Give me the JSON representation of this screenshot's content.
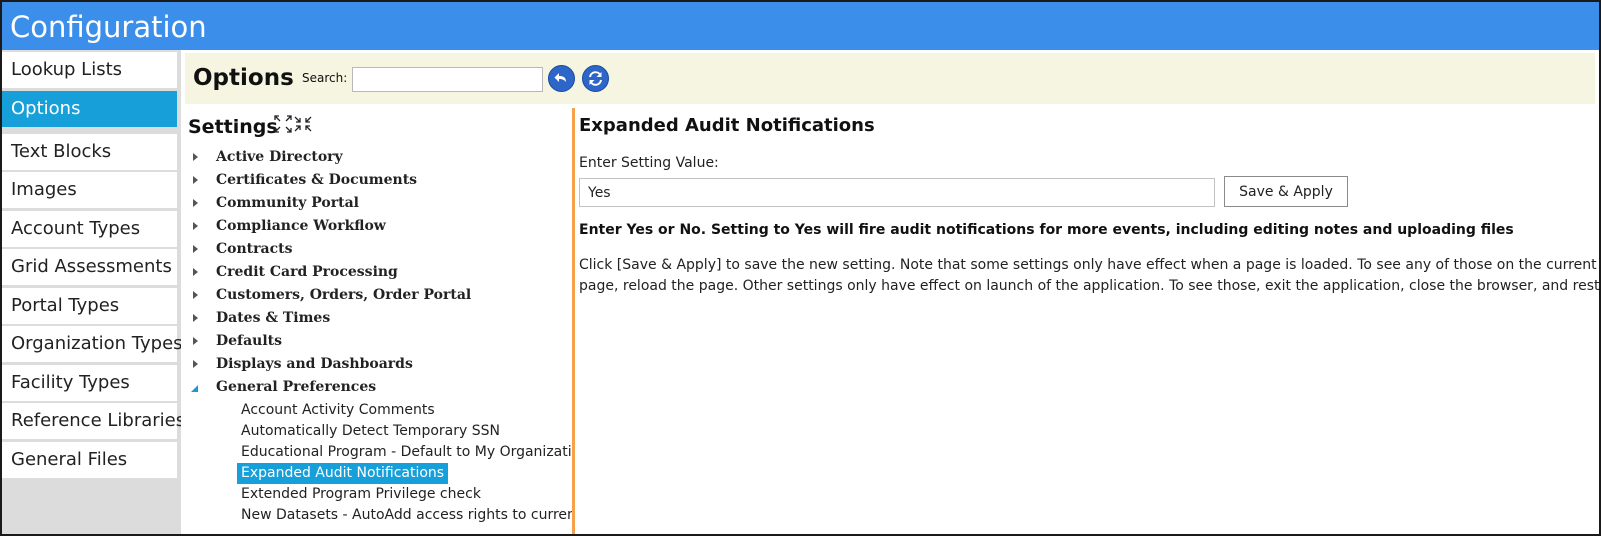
{
  "app": {
    "title": "Configuration"
  },
  "sidebar": {
    "items": [
      {
        "label": "Lookup Lists",
        "active": false
      },
      {
        "label": "Options",
        "active": true
      },
      {
        "label": "Text Blocks",
        "active": false
      },
      {
        "label": "Images",
        "active": false
      },
      {
        "label": "Account Types",
        "active": false
      },
      {
        "label": "Grid Assessments",
        "active": false
      },
      {
        "label": "Portal Types",
        "active": false
      },
      {
        "label": "Organization Types",
        "active": false
      },
      {
        "label": "Facility Types",
        "active": false
      },
      {
        "label": "Reference Libraries",
        "active": false
      },
      {
        "label": "General Files",
        "active": false
      }
    ]
  },
  "toolbar": {
    "title": "Options",
    "search_label": "Search:",
    "search_value": "",
    "back_icon": "back-arrow-icon",
    "refresh_icon": "refresh-icon"
  },
  "settings": {
    "title": "Settings",
    "expand_icon": "expand-all-icon",
    "collapse_icon": "collapse-all-icon",
    "categories": [
      {
        "label": "Active Directory",
        "expanded": false
      },
      {
        "label": "Certificates & Documents",
        "expanded": false
      },
      {
        "label": "Community Portal",
        "expanded": false
      },
      {
        "label": "Compliance Workflow",
        "expanded": false
      },
      {
        "label": "Contracts",
        "expanded": false
      },
      {
        "label": "Credit Card Processing",
        "expanded": false
      },
      {
        "label": "Customers, Orders, Order Portal",
        "expanded": false
      },
      {
        "label": "Dates & Times",
        "expanded": false
      },
      {
        "label": "Defaults",
        "expanded": false
      },
      {
        "label": "Displays and Dashboards",
        "expanded": false
      },
      {
        "label": "General Preferences",
        "expanded": true
      }
    ],
    "children": [
      {
        "label": "Account Activity Comments",
        "selected": false
      },
      {
        "label": "Automatically Detect Temporary SSN",
        "selected": false
      },
      {
        "label": "Educational Program - Default to My Organization",
        "selected": false
      },
      {
        "label": "Expanded Audit Notifications",
        "selected": true
      },
      {
        "label": "Extended Program Privilege check",
        "selected": false
      },
      {
        "label": "New Datasets - AutoAdd access rights to current user",
        "selected": false
      }
    ]
  },
  "detail": {
    "title": "Expanded Audit Notifications",
    "value_label": "Enter Setting Value:",
    "value": "Yes",
    "save_label": "Save & Apply",
    "instruction": "Enter Yes or No. Setting to Yes will fire audit notifications for more events, including editing notes and uploading files",
    "help": "Click [Save & Apply] to save the new setting. Note that some settings only have effect when a page is loaded. To see any of those on the current page, reload the page. Other settings only have effect on launch of the application. To see those, exit the application, close the browser, and restart."
  },
  "colors": {
    "titlebar": "#3b8ee9",
    "accent": "#179fd9",
    "toolbar_bg": "#f5f5e1",
    "divider": "#f5a24a",
    "icon_blue": "#2d66c8"
  }
}
